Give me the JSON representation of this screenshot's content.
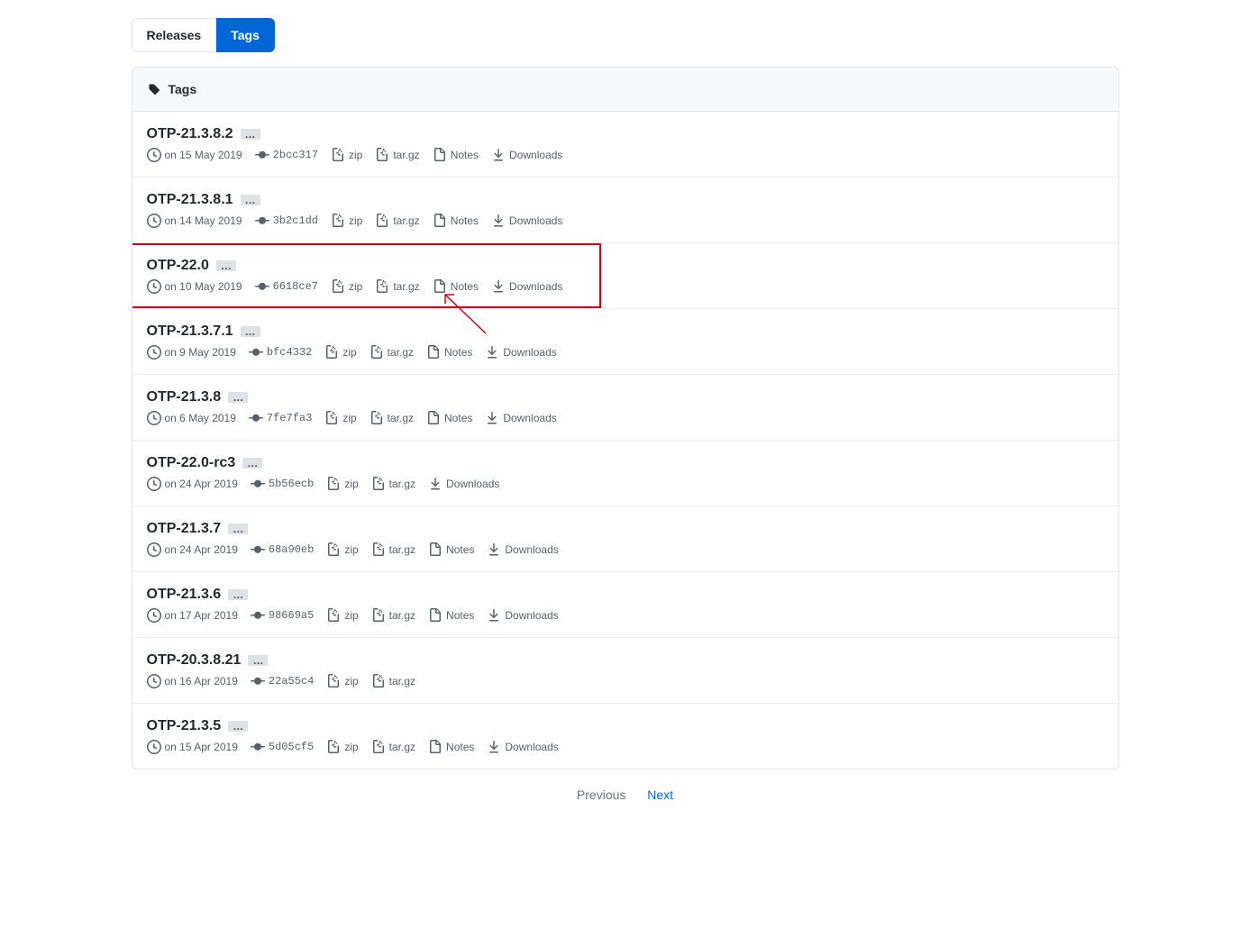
{
  "tabs": {
    "releases": "Releases",
    "tags": "Tags"
  },
  "header": {
    "title": "Tags"
  },
  "labels": {
    "zip": "zip",
    "targz": "tar.gz",
    "notes": "Notes",
    "downloads": "Downloads",
    "date_prefix": "on "
  },
  "tags": [
    {
      "name": "OTP-21.3.8.2",
      "date": "15 May 2019",
      "commit": "2bcc317",
      "notes": true,
      "downloads": true,
      "highlight": false
    },
    {
      "name": "OTP-21.3.8.1",
      "date": "14 May 2019",
      "commit": "3b2c1dd",
      "notes": true,
      "downloads": true,
      "highlight": false
    },
    {
      "name": "OTP-22.0",
      "date": "10 May 2019",
      "commit": "6618ce7",
      "notes": true,
      "downloads": true,
      "highlight": true
    },
    {
      "name": "OTP-21.3.7.1",
      "date": "9 May 2019",
      "commit": "bfc4332",
      "notes": true,
      "downloads": true,
      "highlight": false
    },
    {
      "name": "OTP-21.3.8",
      "date": "6 May 2019",
      "commit": "7fe7fa3",
      "notes": true,
      "downloads": true,
      "highlight": false
    },
    {
      "name": "OTP-22.0-rc3",
      "date": "24 Apr 2019",
      "commit": "5b56ecb",
      "notes": false,
      "downloads": true,
      "highlight": false
    },
    {
      "name": "OTP-21.3.7",
      "date": "24 Apr 2019",
      "commit": "68a90eb",
      "notes": true,
      "downloads": true,
      "highlight": false
    },
    {
      "name": "OTP-21.3.6",
      "date": "17 Apr 2019",
      "commit": "98669a5",
      "notes": true,
      "downloads": true,
      "highlight": false
    },
    {
      "name": "OTP-20.3.8.21",
      "date": "16 Apr 2019",
      "commit": "22a55c4",
      "notes": false,
      "downloads": false,
      "highlight": false
    },
    {
      "name": "OTP-21.3.5",
      "date": "15 Apr 2019",
      "commit": "5d05cf5",
      "notes": true,
      "downloads": true,
      "highlight": false
    }
  ],
  "pagination": {
    "previous": "Previous",
    "next": "Next"
  }
}
